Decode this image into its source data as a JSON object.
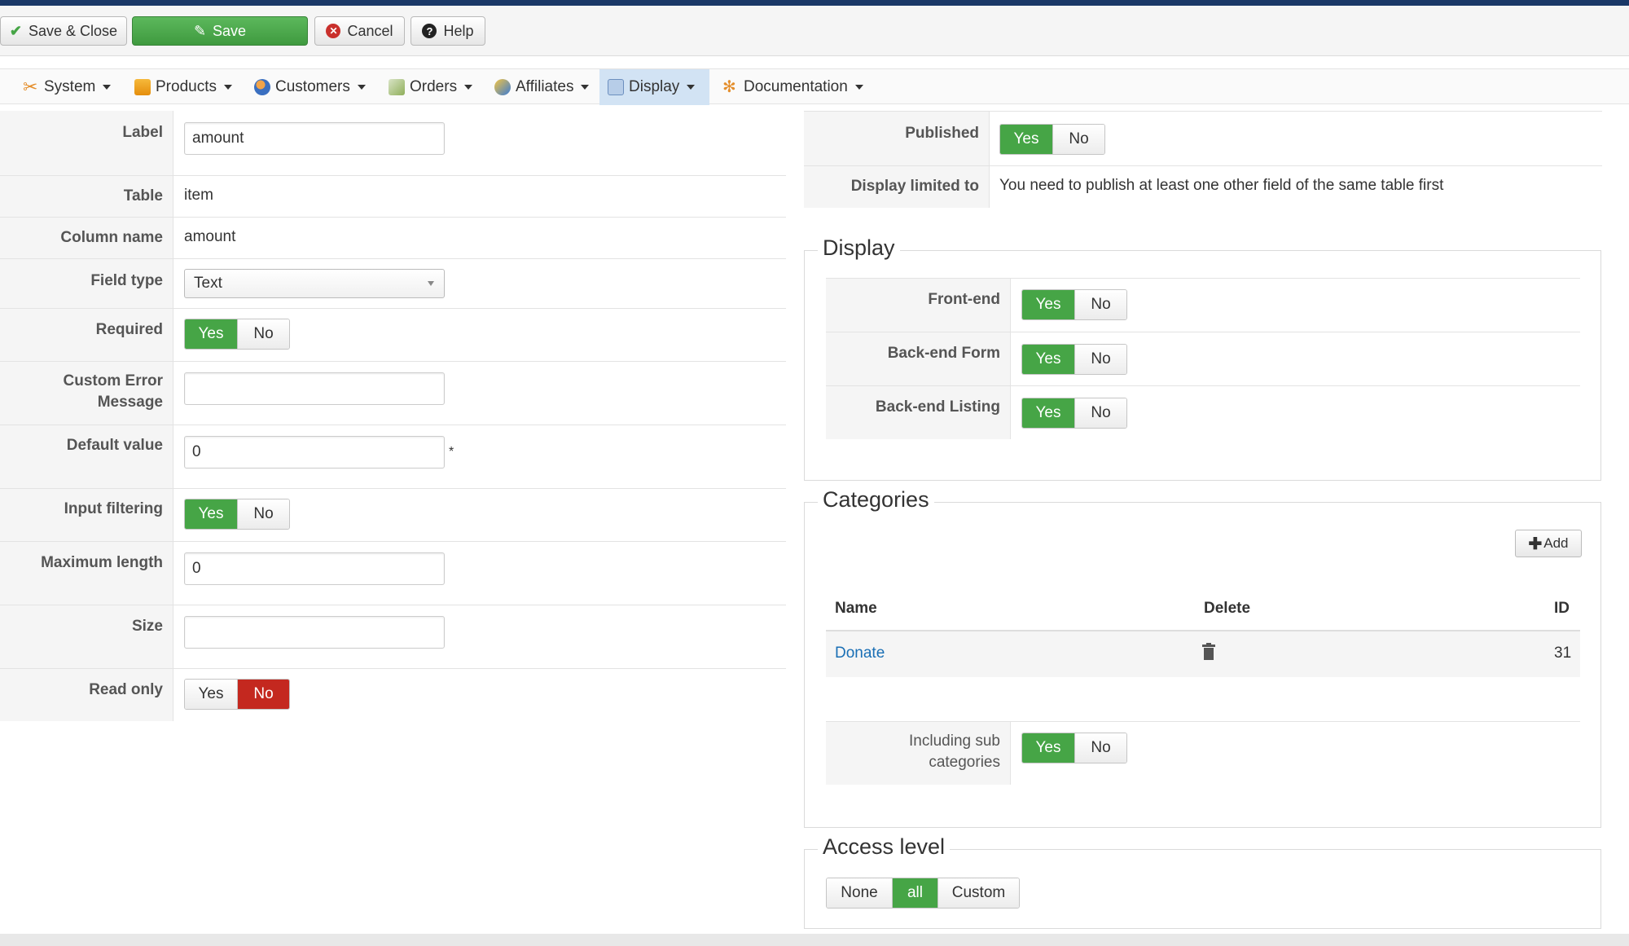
{
  "toolbar": {
    "save_close": "Save & Close",
    "save": "Save",
    "cancel": "Cancel",
    "help": "Help"
  },
  "menu": {
    "items": [
      {
        "label": "System",
        "icon": "wrench-icon"
      },
      {
        "label": "Products",
        "icon": "products-icon"
      },
      {
        "label": "Customers",
        "icon": "customers-icon"
      },
      {
        "label": "Orders",
        "icon": "orders-icon"
      },
      {
        "label": "Affiliates",
        "icon": "affiliates-icon"
      },
      {
        "label": "Display",
        "icon": "display-icon",
        "active": true
      },
      {
        "label": "Documentation",
        "icon": "documentation-icon"
      }
    ]
  },
  "form": {
    "label": {
      "label": "Label",
      "value": "amount"
    },
    "table": {
      "label": "Table",
      "value": "item"
    },
    "column_name": {
      "label": "Column name",
      "value": "amount"
    },
    "field_type": {
      "label": "Field type",
      "value": "Text"
    },
    "required": {
      "label": "Required",
      "yes": "Yes",
      "no": "No",
      "selected": "Yes"
    },
    "custom_error": {
      "label_line1": "Custom Error",
      "label_line2": "Message",
      "value": ""
    },
    "default_value": {
      "label": "Default value",
      "value": "0",
      "star": "*"
    },
    "input_filtering": {
      "label": "Input filtering",
      "yes": "Yes",
      "no": "No",
      "selected": "Yes"
    },
    "maximum_length": {
      "label": "Maximum length",
      "value": "0"
    },
    "size": {
      "label": "Size",
      "value": ""
    },
    "read_only": {
      "label": "Read only",
      "yes": "Yes",
      "no": "No",
      "selected": "No"
    }
  },
  "right": {
    "published": {
      "label": "Published",
      "yes": "Yes",
      "no": "No",
      "selected": "Yes"
    },
    "display_limited": {
      "label": "Display limited to",
      "value": "You need to publish at least one other field of the same table first"
    },
    "display": {
      "legend": "Display",
      "front_end": {
        "label": "Front-end",
        "yes": "Yes",
        "no": "No",
        "selected": "Yes"
      },
      "backend_form": {
        "label": "Back-end Form",
        "yes": "Yes",
        "no": "No",
        "selected": "Yes"
      },
      "backend_listing": {
        "label": "Back-end Listing",
        "yes": "Yes",
        "no": "No",
        "selected": "Yes"
      }
    },
    "categories": {
      "legend": "Categories",
      "add": "Add",
      "headers": {
        "name": "Name",
        "delete": "Delete",
        "id": "ID"
      },
      "rows": [
        {
          "name": "Donate",
          "id": "31"
        }
      ],
      "including_sub": {
        "label_line1": "Including sub",
        "label_line2": "categories",
        "yes": "Yes",
        "no": "No",
        "selected": "Yes"
      }
    },
    "access_level": {
      "legend": "Access level",
      "options": [
        "None",
        "all",
        "Custom"
      ],
      "selected": "all"
    }
  },
  "colors": {
    "accent_green": "#46a546",
    "accent_red": "#c4281f",
    "header_navy": "#1a3867",
    "link_blue": "#1a6fb5"
  }
}
